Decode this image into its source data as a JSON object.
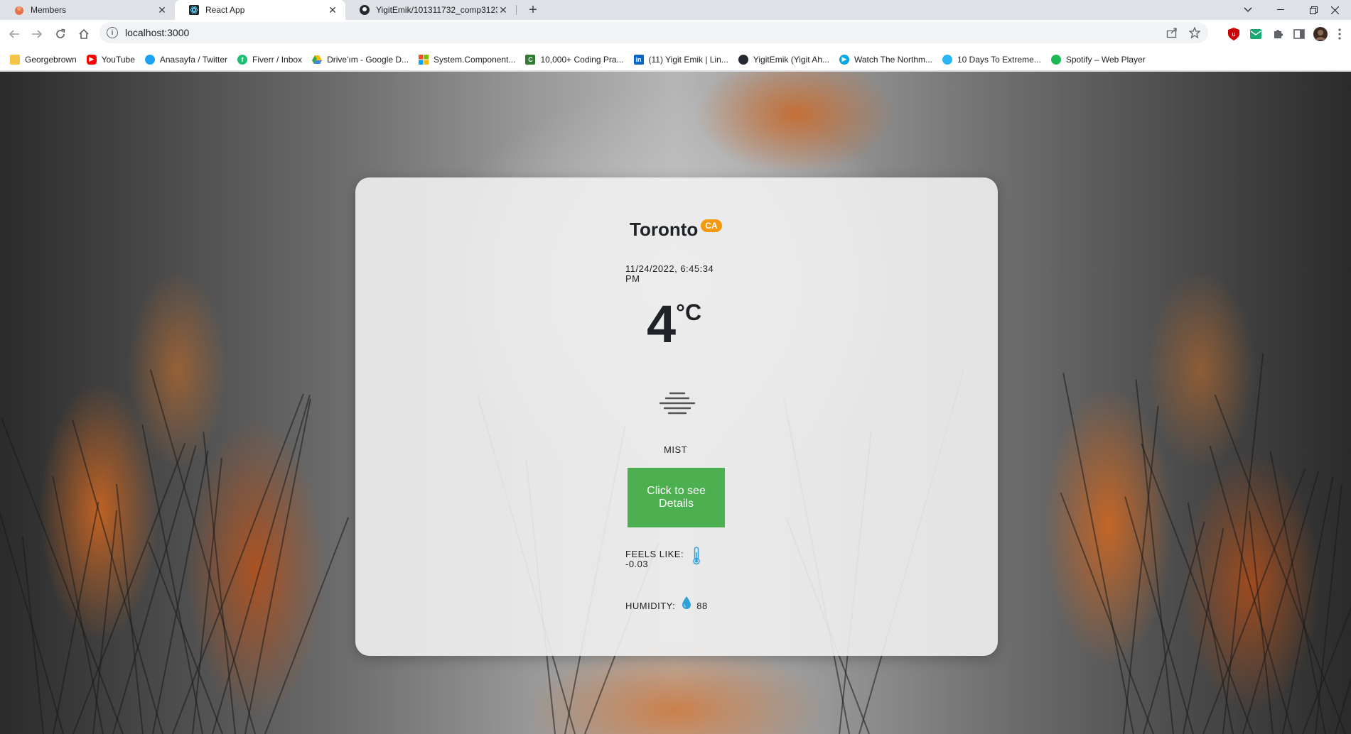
{
  "browser": {
    "tabs": [
      {
        "title": "Members",
        "favicon": "members-favicon",
        "active": false
      },
      {
        "title": "React App",
        "favicon": "react-favicon",
        "active": true
      },
      {
        "title": "YigitEmik/101311732_comp3123",
        "favicon": "github-favicon",
        "active": false
      }
    ],
    "url": "localhost:3000",
    "bookmarks": [
      {
        "label": "Georgebrown",
        "icon": "folder-icon",
        "color": "#f4c542"
      },
      {
        "label": "YouTube",
        "icon": "youtube-icon",
        "color": "#ff0000"
      },
      {
        "label": "Anasayfa / Twitter",
        "icon": "twitter-icon",
        "color": "#1da1f2"
      },
      {
        "label": "Fiverr / Inbox",
        "icon": "fiverr-icon",
        "color": "#1dbf73"
      },
      {
        "label": "Drive'ım - Google D...",
        "icon": "google-drive-icon",
        "color": "#fbbc04"
      },
      {
        "label": "System.Component...",
        "icon": "microsoft-icon",
        "color": "#f25022"
      },
      {
        "label": "10,000+ Coding Pra...",
        "icon": "coding-icon",
        "color": "#2e7d32"
      },
      {
        "label": "(11) Yigit Emik | Lin...",
        "icon": "linkedin-icon",
        "color": "#0a66c2"
      },
      {
        "label": "YigitEmik (Yigit Ah...",
        "icon": "github-icon",
        "color": "#24292f"
      },
      {
        "label": "Watch The Northm...",
        "icon": "play-icon",
        "color": "#00a8e1"
      },
      {
        "label": "10 Days To Extreme...",
        "icon": "link-icon",
        "color": "#29b6f6"
      },
      {
        "label": "Spotify – Web Player",
        "icon": "spotify-icon",
        "color": "#1db954"
      }
    ]
  },
  "weather": {
    "city": "Toronto",
    "country": "CA",
    "datetime": "11/24/2022, 6:45:34 PM",
    "temperature": "4",
    "unit": "°C",
    "condition_icon": "mist-icon",
    "description": "MIST",
    "details_button": "Click to see Details",
    "feels_like_label": "FEELS LIKE:",
    "feels_like_value": "-0.03",
    "humidity_label": "HUMIDITY:",
    "humidity_value": "88"
  },
  "colors": {
    "badge": "#f59a10",
    "button": "#4caf50",
    "icon_blue": "#2f9fd8"
  }
}
